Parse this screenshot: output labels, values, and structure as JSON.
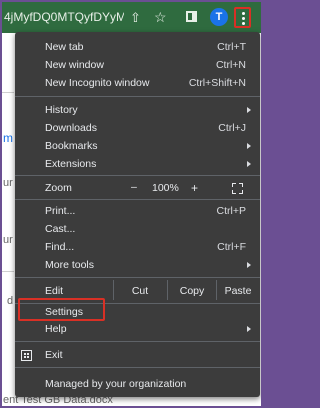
{
  "browser": {
    "url_text": "4jMyfDQ0MTQyfDYyM..."
  },
  "avatar": {
    "initial": "T"
  },
  "background": {
    "left_fragment": "m",
    "ur_1": "ur",
    "ur_2": "ur",
    "d_fragment": "d",
    "bottom_text": "ent Test GB Data.docx"
  },
  "menu": {
    "new_tab": {
      "label": "New tab",
      "shortcut": "Ctrl+T"
    },
    "new_window": {
      "label": "New window",
      "shortcut": "Ctrl+N"
    },
    "new_incognito": {
      "label": "New Incognito window",
      "shortcut": "Ctrl+Shift+N"
    },
    "history": {
      "label": "History"
    },
    "downloads": {
      "label": "Downloads",
      "shortcut": "Ctrl+J"
    },
    "bookmarks": {
      "label": "Bookmarks"
    },
    "extensions": {
      "label": "Extensions"
    },
    "zoom": {
      "label": "Zoom",
      "minus": "–",
      "value": "100%",
      "plus": "+"
    },
    "print": {
      "label": "Print...",
      "shortcut": "Ctrl+P"
    },
    "cast": {
      "label": "Cast..."
    },
    "find": {
      "label": "Find...",
      "shortcut": "Ctrl+F"
    },
    "more_tools": {
      "label": "More tools"
    },
    "edit": {
      "label": "Edit",
      "cut": "Cut",
      "copy": "Copy",
      "paste": "Paste"
    },
    "settings": {
      "label": "Settings"
    },
    "help": {
      "label": "Help"
    },
    "exit": {
      "label": "Exit"
    },
    "managed": {
      "label": "Managed by your organization"
    }
  },
  "colors": {
    "toolbar": "#2f6b3f",
    "menu_bg": "#3c3c3c",
    "highlight": "#d93025"
  }
}
